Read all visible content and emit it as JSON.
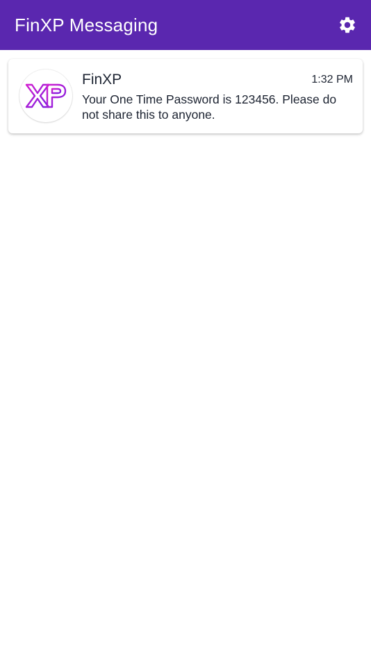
{
  "app_bar": {
    "title": "FinXP Messaging",
    "settings_icon": "gear-icon",
    "background_color": "#5a27af"
  },
  "messages": [
    {
      "avatar_icon": "finxp-logo",
      "avatar_text": "XP",
      "sender": "FinXP",
      "time": "1:32 PM",
      "body": "Your One Time Password is 123456. Please do not share this to anyone."
    }
  ],
  "colors": {
    "logo_gradient_start": "#c81fd6",
    "logo_gradient_end": "#7a1fe0",
    "text": "#1c2331"
  }
}
